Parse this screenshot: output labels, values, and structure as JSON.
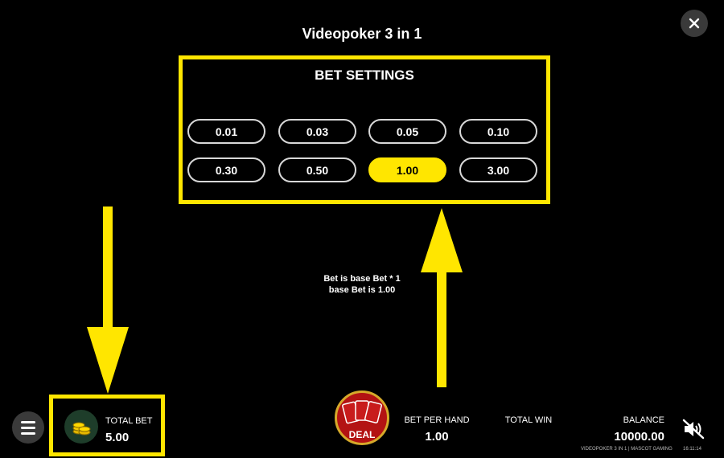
{
  "game": {
    "title": "Videopoker 3 in 1"
  },
  "bet_settings": {
    "title": "BET SETTINGS",
    "options": [
      "0.01",
      "0.03",
      "0.05",
      "0.10",
      "0.30",
      "0.50",
      "1.00",
      "3.00"
    ],
    "selected": "1.00"
  },
  "info": {
    "line1": "Bet is base Bet * 1",
    "line2": "base Bet is 1.00"
  },
  "bottom": {
    "total_bet_label": "TOTAL BET",
    "total_bet_value": "5.00",
    "deal_label": "DEAL",
    "bet_per_hand_label": "BET PER HAND",
    "bet_per_hand_value": "1.00",
    "total_win_label": "TOTAL WIN",
    "balance_label": "BALANCE",
    "balance_value": "10000.00",
    "footer": "VIDEOPOKER 3 IN 1 | MASCOT GAMING",
    "time": "16:11:14"
  },
  "icons": {
    "close": "close-icon",
    "menu": "hamburger-icon",
    "coins": "coins-icon",
    "cards": "playing-cards-icon",
    "sound": "sound-muted-icon"
  },
  "colors": {
    "accent": "#ffe600",
    "background": "#000000",
    "deal_button": "#b31313"
  }
}
